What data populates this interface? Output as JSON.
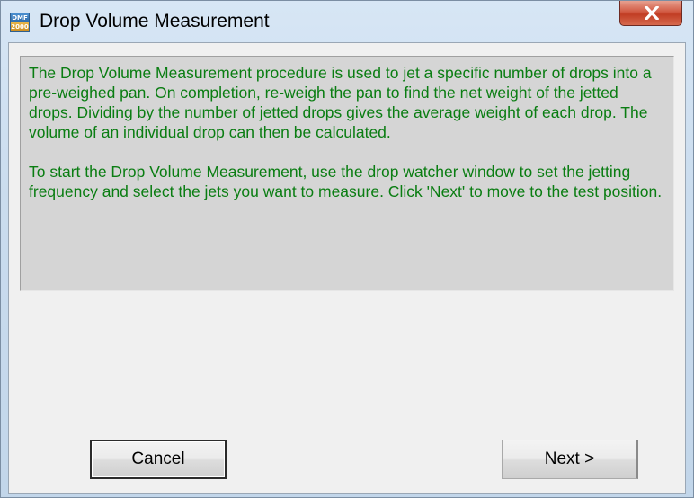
{
  "window": {
    "title": "Drop Volume Measurement",
    "app_icon_text": [
      "DMF",
      "2000"
    ]
  },
  "info": {
    "paragraph1": "The Drop Volume Measurement procedure is used to jet a specific number of drops into a pre-weighed pan. On completion, re-weigh the pan to find the net weight of the jetted drops. Dividing by the number of jetted drops gives the average weight of each drop. The volume of an individual drop can then be calculated.",
    "paragraph2": "To start the Drop Volume Measurement, use the drop watcher window to set the jetting frequency and select the jets you want to measure. Click 'Next' to move to the test position.",
    "text_color": "#0a7d12"
  },
  "buttons": {
    "cancel_label": "Cancel",
    "next_label": "Next >"
  },
  "icons": {
    "close": "close-icon",
    "app": "app-icon"
  }
}
